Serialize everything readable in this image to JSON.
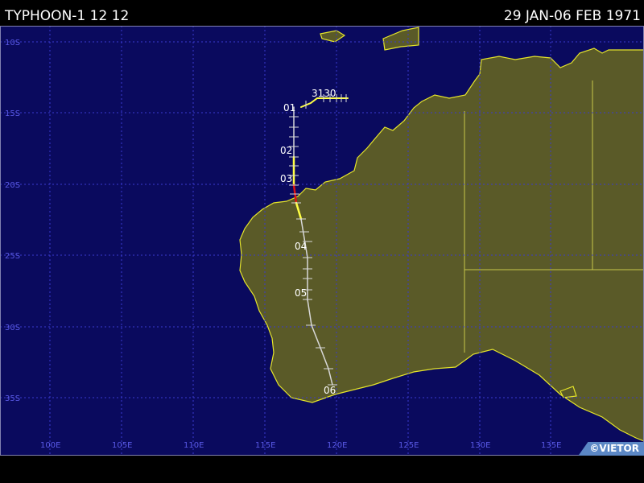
{
  "header": {
    "title": "TYPHOON-1 12 12",
    "dates": "29 JAN-06 FEB 1971"
  },
  "map": {
    "ocean_color": "#0a0a5e",
    "land_color": "#5a5a28",
    "coast_color": "#e5e52a",
    "grid_color": "#3a3ad0",
    "lat_labels": [
      "10S",
      "15S",
      "20S",
      "25S",
      "30S",
      "35S"
    ],
    "lon_labels": [
      "100E",
      "105E",
      "110E",
      "115E",
      "120E",
      "125E",
      "130E",
      "135E"
    ]
  },
  "track": {
    "day_labels": [
      "3130",
      "01",
      "02",
      "03",
      "04",
      "05",
      "06"
    ],
    "colors": {
      "depression": "#d8d8d8",
      "storm": "#ffff44",
      "typhoon": "#dd1111"
    }
  },
  "credit": "©VIETOR"
}
